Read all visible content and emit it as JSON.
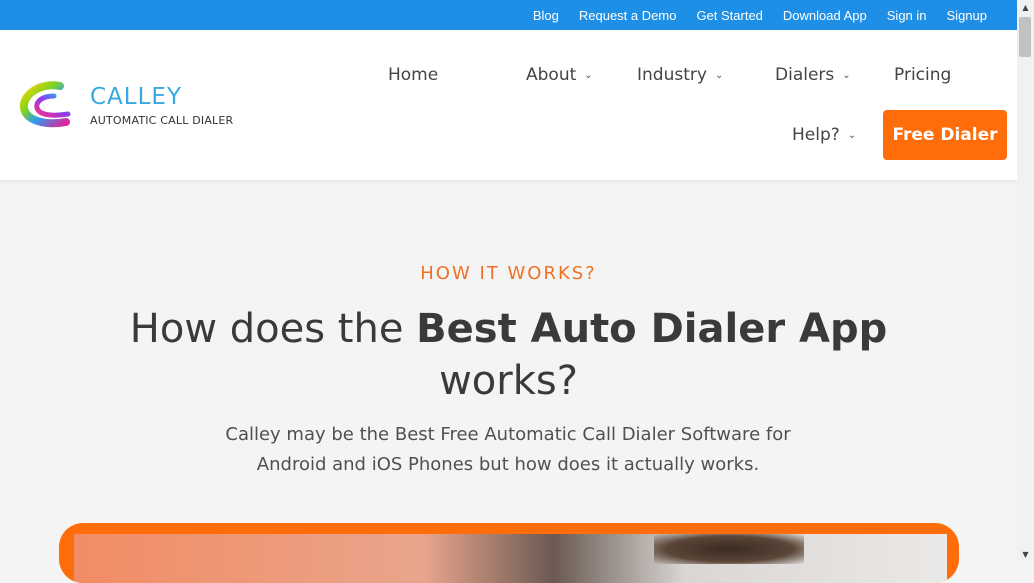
{
  "topbar": {
    "links": [
      "Blog",
      "Request a Demo",
      "Get Started",
      "Download App",
      "Sign in",
      "Signup"
    ]
  },
  "logo": {
    "name": "CALLEY",
    "tagline": "AUTOMATIC CALL DIALER"
  },
  "nav": {
    "home": "Home",
    "about": "About",
    "industry": "Industry",
    "dialers": "Dialers",
    "pricing": "Pricing",
    "help": "Help?",
    "cta": "Free Dialer"
  },
  "hero": {
    "eyebrow": "HOW IT WORKS?",
    "headline_plain": "How does the ",
    "headline_bold": "Best Auto Dialer App",
    "headline_line2": "works?",
    "subtext": "Calley may be the Best Free Automatic Call Dialer Software for Android and iOS Phones but how does it actually works."
  },
  "colors": {
    "topbar": "#1e8fe6",
    "accent": "#ff6d0a",
    "eyebrow": "#f07124"
  },
  "icons": {
    "dropdown": "chevron-down-icon",
    "logo": "calley-swirl-logo"
  }
}
